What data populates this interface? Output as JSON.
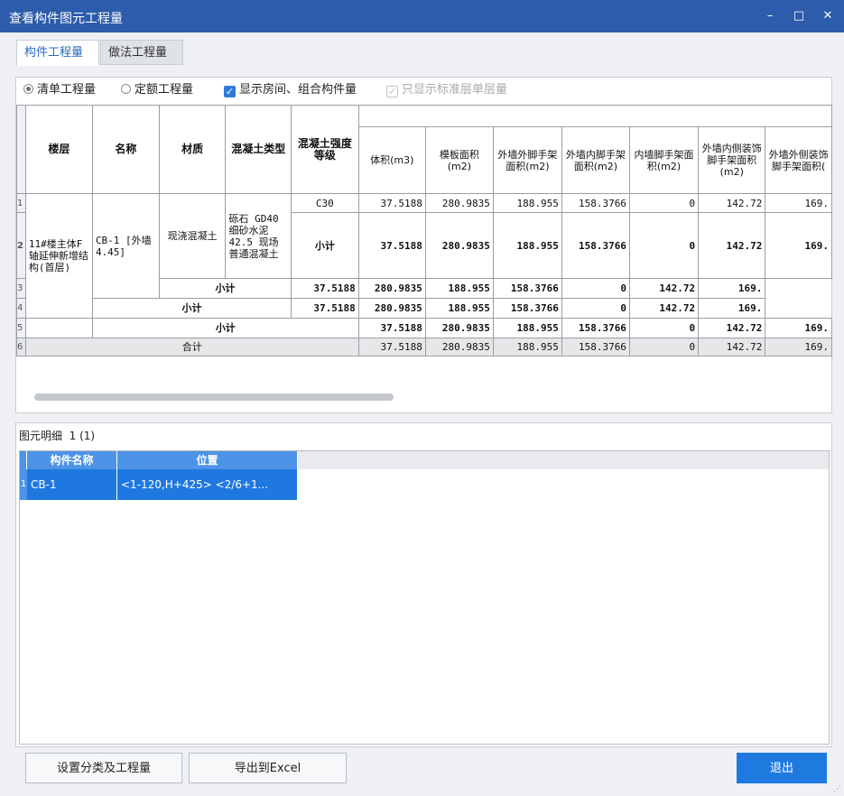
{
  "window": {
    "title": "查看构件图元工程量",
    "minimize": "–",
    "maximize": "□",
    "close": "✕"
  },
  "tabs": [
    {
      "label": "构件工程量"
    },
    {
      "label": "做法工程量"
    }
  ],
  "options": {
    "radio_bill": "清单工程量",
    "radio_quota": "定额工程量",
    "chk_show_rooms": "显示房间、组合构件量",
    "chk_std_floor": "只显示标准层单层量"
  },
  "table": {
    "headers": {
      "floor": "楼层",
      "name": "名称",
      "material": "材质",
      "concrete_type": "混凝土类型",
      "concrete_grade": "混凝土强度等级",
      "volume": "体积(m3)",
      "formwork": "模板面积(m2)",
      "ext_scaffold": "外墙外脚手架面积(m2)",
      "ext_inner_scaffold": "外墙内脚手架面积(m2)",
      "int_scaffold": "内墙脚手架面积(m2)",
      "ext_inner_deco": "外墙内侧装饰脚手架面积(m2)",
      "ext_outer_deco": "外墙外侧装饰脚手架面积("
    },
    "row_numbers": [
      "1",
      "2",
      "3",
      "4",
      "5",
      "6"
    ],
    "floor": "11#楼主体F轴延伸新增结构(首层)",
    "name": "CB-1 [外墙 4.45]",
    "material": "现浇混凝土",
    "concrete_type": "砾石 GD40 细砂水泥42.5 现场普通混凝土",
    "grade": "C30",
    "subtotal": "小计",
    "total": "合计",
    "values": [
      "37.5188",
      "280.9835",
      "188.955",
      "158.3766",
      "0",
      "142.72",
      "169."
    ]
  },
  "detail": {
    "title": "图元明细",
    "count": "1 (1)",
    "columns": [
      "构件名称",
      "位置"
    ],
    "rows": [
      {
        "num": "1",
        "name": "CB-1",
        "position": "<1-120,H+425> <2/6+1..."
      }
    ]
  },
  "buttons": {
    "settings": "设置分类及工程量",
    "export": "导出到Excel",
    "exit": "退出"
  }
}
